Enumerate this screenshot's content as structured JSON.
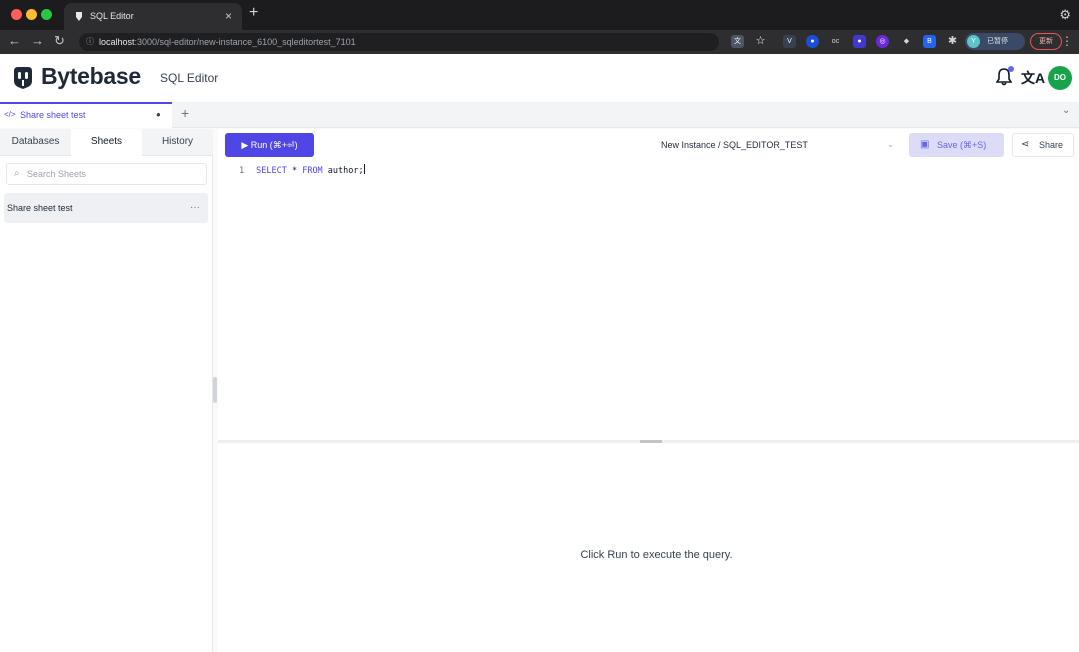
{
  "browser": {
    "tab_title": "SQL Editor",
    "url_host": "localhost",
    "url_path": ":3000/sql-editor/new-instance_6100_sqleditortest_7101",
    "profile_label": "已暂停",
    "profile_initial": "Y",
    "update_label": "更新"
  },
  "header": {
    "brand": "Bytebase",
    "title": "SQL Editor",
    "avatar_initials": "DO",
    "lang_icon": "文A"
  },
  "sheet_tabs": [
    {
      "label": "Share sheet test",
      "active": true
    }
  ],
  "sidebar": {
    "tabs": [
      {
        "label": "Databases",
        "active": false
      },
      {
        "label": "Sheets",
        "active": true
      },
      {
        "label": "History",
        "active": false
      }
    ],
    "search_placeholder": "Search Sheets",
    "sheets": [
      {
        "name": "Share sheet test"
      }
    ]
  },
  "editor": {
    "run_label": "▶ Run (⌘+⏎)",
    "connection": "New Instance / SQL_EDITOR_TEST",
    "save_label": "Save (⌘+S)",
    "share_label": "Share",
    "lines": [
      {
        "number": "1",
        "keyword1": "SELECT",
        "middle": " * ",
        "keyword2": "FROM",
        "rest": " author;"
      }
    ]
  },
  "results": {
    "empty_message": "Click Run to execute the query."
  },
  "colors": {
    "accent": "#4f46e5",
    "avatar": "#16a34a",
    "browser_chrome": "#1c1c1e"
  }
}
